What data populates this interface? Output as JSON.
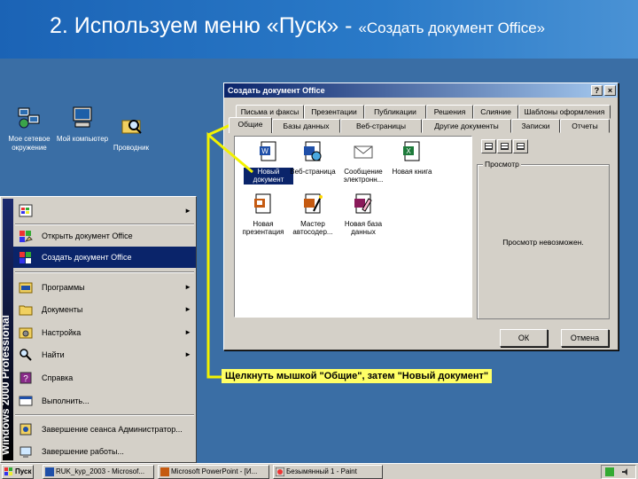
{
  "slide": {
    "title": "2. Используем меню «Пуск» - ",
    "subtitle": "«Создать документ Office»"
  },
  "desktop": {
    "icons": [
      {
        "label": "Мое сетевое окружение",
        "icon": "network-icon"
      },
      {
        "label": "Мой компьютер",
        "icon": "computer-icon"
      },
      {
        "label": "Проводник",
        "icon": "explorer-icon"
      }
    ]
  },
  "dialog": {
    "title": "Создать документ Office",
    "help_label": "?",
    "close_label": "×",
    "tabs_back": [
      "Письма и факсы",
      "Презентации",
      "Публикации",
      "Решения",
      "Слияние",
      "Шаблоны оформления"
    ],
    "tabs_front": [
      "Общие",
      "Базы данных",
      "Веб-страницы",
      "Другие документы",
      "Записки",
      "Отчеты"
    ],
    "active_tab": "Общие",
    "items": [
      {
        "label": "Новый документ",
        "icon": "word-doc-icon",
        "selected": true
      },
      {
        "label": "Веб-страница",
        "icon": "web-page-icon",
        "selected": false
      },
      {
        "label": "Сообщение электронн...",
        "icon": "envelope-icon",
        "selected": false
      },
      {
        "label": "Новая книга",
        "icon": "excel-icon",
        "selected": false
      },
      {
        "label": "Новая презентация",
        "icon": "powerpoint-icon",
        "selected": false
      },
      {
        "label": "Мастер автосодер...",
        "icon": "wizard-icon",
        "selected": false
      },
      {
        "label": "Новая база данных",
        "icon": "access-icon",
        "selected": false
      }
    ],
    "preview_label": "Просмотр",
    "preview_text": "Просмотр невозможен.",
    "ok_label": "ОК",
    "cancel_label": "Отмена"
  },
  "start_menu": {
    "banner": "Windows 2000 Professional",
    "items": [
      {
        "label": "",
        "icon": "windows-update-icon",
        "arrow": true,
        "highlighted": false
      },
      {
        "label": "Открыть документ Office",
        "icon": "open-office-doc-icon",
        "arrow": false,
        "highlighted": false
      },
      {
        "label": "Создать документ Office",
        "icon": "new-office-doc-icon",
        "arrow": false,
        "highlighted": true
      },
      {
        "label": "Программы",
        "icon": "programs-icon",
        "arrow": true,
        "highlighted": false
      },
      {
        "label": "Документы",
        "icon": "documents-icon",
        "arrow": true,
        "highlighted": false
      },
      {
        "label": "Настройка",
        "icon": "settings-icon",
        "arrow": true,
        "highlighted": false
      },
      {
        "label": "Найти",
        "icon": "search-icon",
        "arrow": true,
        "highlighted": false
      },
      {
        "label": "Справка",
        "icon": "help-icon",
        "arrow": false,
        "highlighted": false
      },
      {
        "label": "Выполнить...",
        "icon": "run-icon",
        "arrow": false,
        "highlighted": false
      },
      {
        "label": "Завершение сеанса Администратор...",
        "icon": "logoff-icon",
        "arrow": false,
        "highlighted": false
      },
      {
        "label": "Завершение работы...",
        "icon": "shutdown-icon",
        "arrow": false,
        "highlighted": false
      }
    ]
  },
  "taskbar": {
    "start_label": "Пуск",
    "tasks": [
      "RUK_kyp_2003 - Microsof...",
      "Microsoft PowerPoint - [И...",
      "Безымянный 1 - Paint"
    ]
  },
  "callout": {
    "text": "Щелкнуть мышкой \"Общие\", затем \"Новый документ\""
  },
  "colors": {
    "desktop": "#3a6ea5",
    "titlebar": "#0a246a",
    "callout": "#ffff66",
    "callout_line": "#f2f200"
  }
}
